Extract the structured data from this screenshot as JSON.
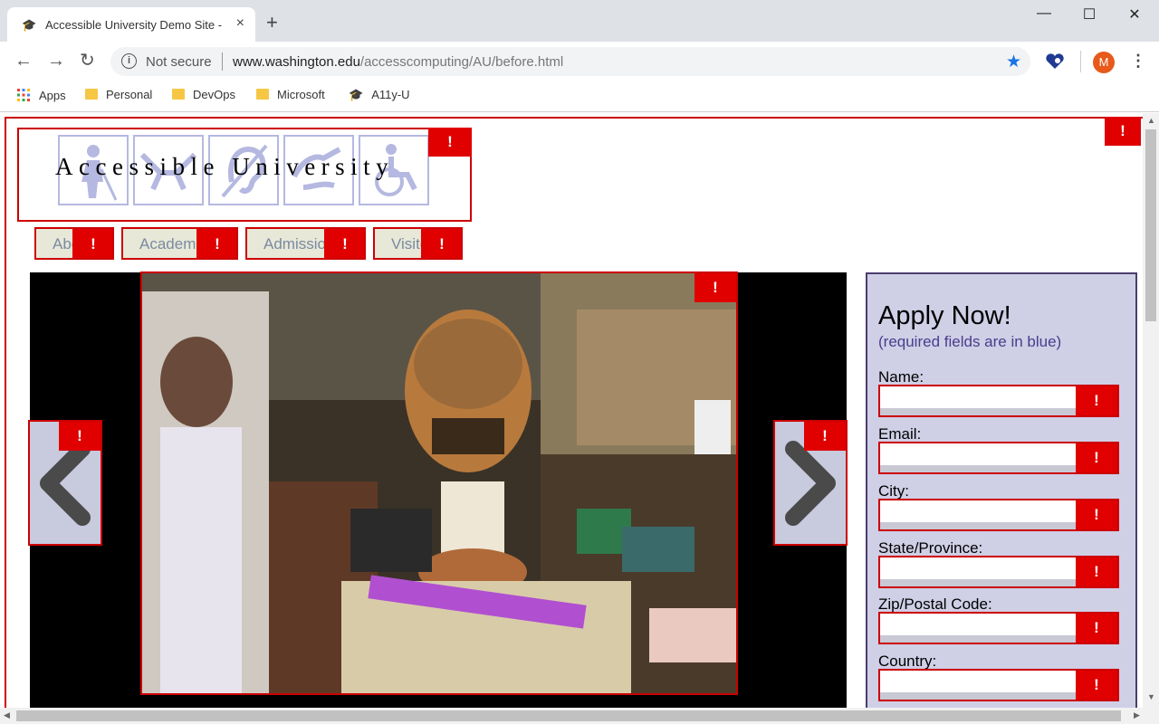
{
  "browser": {
    "tab_title": "Accessible University Demo Site -",
    "tab_close": "×",
    "new_tab": "+",
    "security_label": "Not secure",
    "url_host": "www.washington.edu",
    "url_path": "/accesscomputing/AU/before.html",
    "avatar_letter": "M",
    "bookmarks": [
      "Apps",
      "Personal",
      "DevOps",
      "Microsoft",
      "A11y-U"
    ]
  },
  "page": {
    "logo_text": "Accessible University",
    "nav_tabs": [
      "About",
      "Academics",
      "Admissions",
      "Visitors"
    ],
    "error_flag": "!",
    "apply": {
      "title": "Apply Now!",
      "subtitle": "(required fields are in blue)",
      "fields": [
        "Name:",
        "Email:",
        "City:",
        "State/Province:",
        "Zip/Postal Code:",
        "Country:"
      ]
    }
  },
  "colors": {
    "error_red": "#e00000",
    "form_bg": "#cfcfe6",
    "logo_icon": "#b5b8e0"
  }
}
